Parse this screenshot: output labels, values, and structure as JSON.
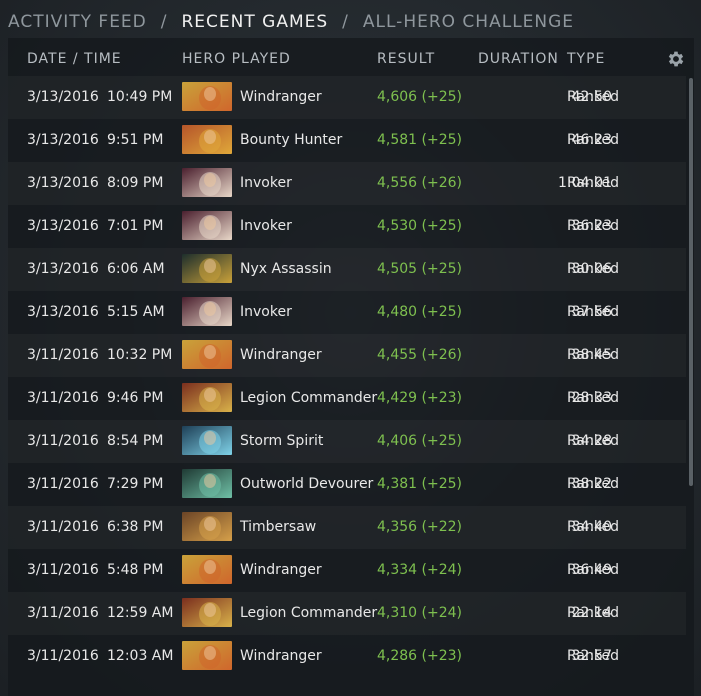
{
  "nav": {
    "tabs": [
      {
        "label": "ACTIVITY FEED",
        "active": false
      },
      {
        "label": "RECENT GAMES",
        "active": true
      },
      {
        "label": "ALL-HERO CHALLENGE",
        "active": false
      }
    ],
    "separator": "/"
  },
  "table": {
    "headers": {
      "datetime": "DATE / TIME",
      "hero": "HERO PLAYED",
      "result": "RESULT",
      "duration": "DURATION",
      "type": "TYPE"
    },
    "settings_icon": "gear-icon",
    "rows": [
      {
        "date": "3/13/2016",
        "time": "10:49 PM",
        "hero": "Windranger",
        "result": "4,606 (+25)",
        "duration": "42:50",
        "type": "Ranked"
      },
      {
        "date": "3/13/2016",
        "time": "9:51 PM",
        "hero": "Bounty Hunter",
        "result": "4,581 (+25)",
        "duration": "46:23",
        "type": "Ranked"
      },
      {
        "date": "3/13/2016",
        "time": "8:09 PM",
        "hero": "Invoker",
        "result": "4,556 (+26)",
        "duration": "1:04:01",
        "type": "Ranked"
      },
      {
        "date": "3/13/2016",
        "time": "7:01 PM",
        "hero": "Invoker",
        "result": "4,530 (+25)",
        "duration": "36:23",
        "type": "Ranked"
      },
      {
        "date": "3/13/2016",
        "time": "6:06 AM",
        "hero": "Nyx Assassin",
        "result": "4,505 (+25)",
        "duration": "30:06",
        "type": "Ranked"
      },
      {
        "date": "3/13/2016",
        "time": "5:15 AM",
        "hero": "Invoker",
        "result": "4,480 (+25)",
        "duration": "37:56",
        "type": "Ranked"
      },
      {
        "date": "3/11/2016",
        "time": "10:32 PM",
        "hero": "Windranger",
        "result": "4,455 (+26)",
        "duration": "38:45",
        "type": "Ranked"
      },
      {
        "date": "3/11/2016",
        "time": "9:46 PM",
        "hero": "Legion Commander",
        "result": "4,429 (+23)",
        "duration": "28:33",
        "type": "Ranked"
      },
      {
        "date": "3/11/2016",
        "time": "8:54 PM",
        "hero": "Storm Spirit",
        "result": "4,406 (+25)",
        "duration": "34:28",
        "type": "Ranked"
      },
      {
        "date": "3/11/2016",
        "time": "7:29 PM",
        "hero": "Outworld Devourer",
        "result": "4,381 (+25)",
        "duration": "38:22",
        "type": "Ranked"
      },
      {
        "date": "3/11/2016",
        "time": "6:38 PM",
        "hero": "Timbersaw",
        "result": "4,356 (+22)",
        "duration": "34:40",
        "type": "Ranked"
      },
      {
        "date": "3/11/2016",
        "time": "5:48 PM",
        "hero": "Windranger",
        "result": "4,334 (+24)",
        "duration": "36:49",
        "type": "Ranked"
      },
      {
        "date": "3/11/2016",
        "time": "12:59 AM",
        "hero": "Legion Commander",
        "result": "4,310 (+24)",
        "duration": "22:14",
        "type": "Ranked"
      },
      {
        "date": "3/11/2016",
        "time": "12:03 AM",
        "hero": "Windranger",
        "result": "4,286 (+23)",
        "duration": "32:57",
        "type": "Ranked"
      }
    ]
  },
  "colors": {
    "result_green": "#7ec04f",
    "portraits": {
      "Windranger": [
        "#c9a23a",
        "#d0662c"
      ],
      "Bounty Hunter": [
        "#b5552a",
        "#e0a83a"
      ],
      "Invoker": [
        "#4a1f2e",
        "#e8d7c8"
      ],
      "Nyx Assassin": [
        "#1d2e2c",
        "#c9a13a"
      ],
      "Legion Commander": [
        "#7a2e1e",
        "#d9b24a"
      ],
      "Storm Spirit": [
        "#1e3f56",
        "#7fd2e8"
      ],
      "Outworld Devourer": [
        "#1f3a34",
        "#6fc0a6"
      ],
      "Timbersaw": [
        "#6b4426",
        "#d6a04a"
      ]
    }
  }
}
